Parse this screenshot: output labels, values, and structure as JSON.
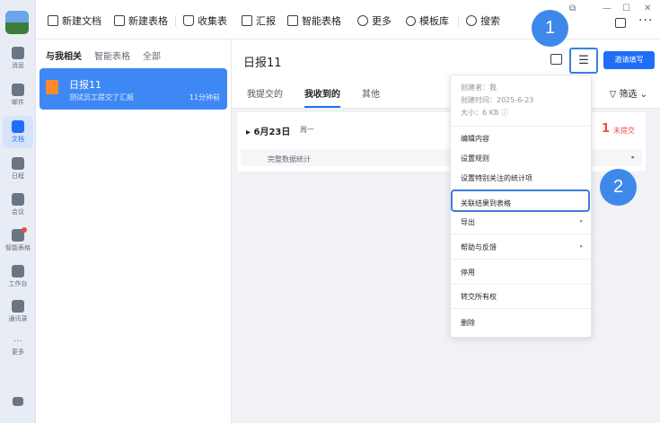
{
  "sidebar": {
    "items": [
      {
        "label": "消息",
        "icon": "chat-icon"
      },
      {
        "label": "邮件",
        "icon": "mail-icon"
      },
      {
        "label": "文档",
        "icon": "docs-icon"
      },
      {
        "label": "日程",
        "icon": "calendar-icon"
      },
      {
        "label": "会议",
        "icon": "meeting-icon"
      },
      {
        "label": "智能表格",
        "icon": "smart-sheet-icon"
      },
      {
        "label": "工作台",
        "icon": "workbench-icon"
      },
      {
        "label": "通讯录",
        "icon": "contacts-icon"
      },
      {
        "label": "更多",
        "icon": "more-icon"
      }
    ]
  },
  "toolbar": {
    "new_doc": "新建文档",
    "new_sheet": "新建表格",
    "collect": "收集表",
    "report": "汇报",
    "smart_sheet": "智能表格",
    "more": "更多",
    "templates": "模板库",
    "search": "搜索"
  },
  "list": {
    "tabs": [
      "与我相关",
      "智能表格",
      "全部"
    ],
    "card": {
      "title": "日报11",
      "subtitle": "测试员工提交了汇报",
      "time": "11分钟前"
    }
  },
  "main": {
    "title": "日报11",
    "tabs": [
      "我提交的",
      "我收到的",
      "其他"
    ],
    "filter": "筛选",
    "invite": "邀请填写",
    "day": "6月23日",
    "weekday": "周一",
    "count": "1",
    "count_label": "未提交",
    "stat_label": "完整数据统计"
  },
  "menu": {
    "creator": "创建者：我",
    "created": "创建时间：2025-6-23",
    "size": "大小：6 KB",
    "items": [
      "编辑内容",
      "设置规则",
      "设置特别关注的统计项",
      "关联结果到表格",
      "导出",
      "帮助与反馈",
      "停用",
      "转交所有权",
      "删除"
    ]
  },
  "annotations": {
    "one": "1",
    "two": "2"
  },
  "colors": {
    "accent": "#1f6ef7",
    "badge": "#3e88ea",
    "alert": "#f04848"
  }
}
